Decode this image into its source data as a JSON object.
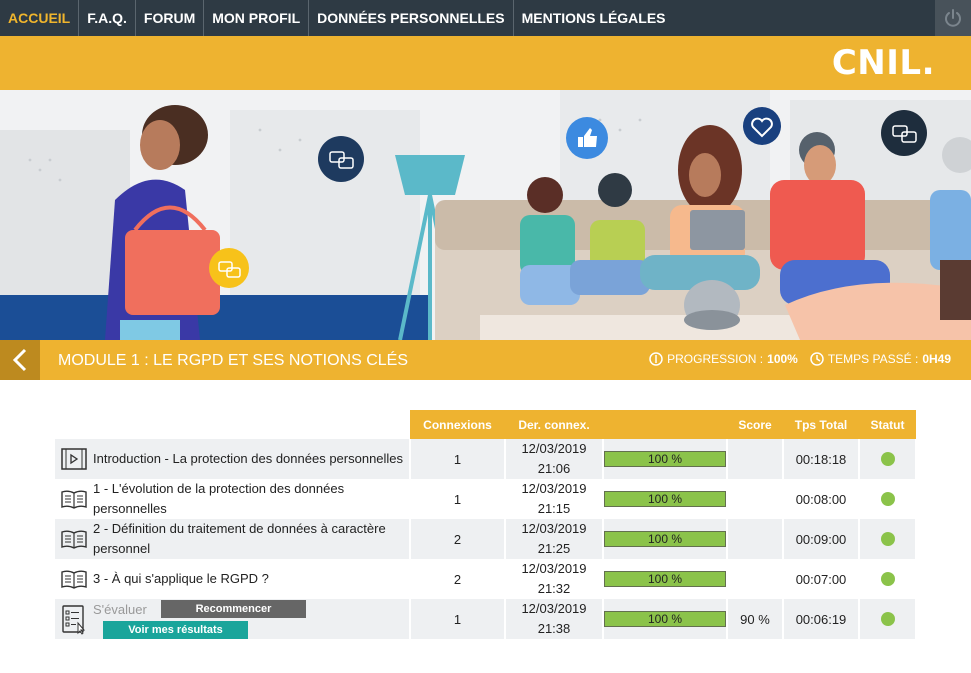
{
  "nav": {
    "items": [
      {
        "label": "ACCUEIL",
        "active": true
      },
      {
        "label": "F.A.Q."
      },
      {
        "label": "FORUM"
      },
      {
        "label": "MON PROFIL"
      },
      {
        "label": "DONNÉES PERSONNELLES"
      },
      {
        "label": "MENTIONS LÉGALES"
      }
    ],
    "power_icon": "power-icon"
  },
  "brand": {
    "logo": "CNIL."
  },
  "module": {
    "title": "MODULE 1 : LE RGPD ET SES NOTIONS CLÉS",
    "progress_label": "PROGRESSION :",
    "progress_value": "100%",
    "time_label": "TEMPS PASSÉ :",
    "time_value": "0H49"
  },
  "table": {
    "headers": [
      "Connexions",
      "Der. connex.",
      "Score",
      "Tps Total",
      "Statut"
    ],
    "rows": [
      {
        "icon": "video-icon",
        "title": "Introduction - La protection des données personnelles",
        "connexions": "1",
        "date": "12/03/2019",
        "time": "21:06",
        "progress": "100 %",
        "score": "",
        "total": "00:18:18",
        "status": "complete"
      },
      {
        "icon": "book-icon",
        "title": "1 - L'évolution de la protection des données personnelles",
        "connexions": "1",
        "date": "12/03/2019",
        "time": "21:15",
        "progress": "100 %",
        "score": "",
        "total": "00:08:00",
        "status": "complete"
      },
      {
        "icon": "book-icon",
        "title": "2 - Définition du traitement de données à caractère personnel",
        "connexions": "2",
        "date": "12/03/2019",
        "time": "21:25",
        "progress": "100 %",
        "score": "",
        "total": "00:09:00",
        "status": "complete"
      },
      {
        "icon": "book-icon",
        "title": "3 - À qui s'applique le RGPD ?",
        "connexions": "2",
        "date": "12/03/2019",
        "time": "21:32",
        "progress": "100 %",
        "score": "",
        "total": "00:07:00",
        "status": "complete"
      }
    ],
    "eval": {
      "icon": "quiz-icon",
      "label": "S'évaluer",
      "restart_label": "Recommencer",
      "results_label": "Voir mes résultats",
      "connexions": "1",
      "date": "12/03/2019",
      "time": "21:38",
      "progress": "100 %",
      "score": "90 %",
      "total": "00:06:19",
      "status": "complete"
    }
  },
  "colors": {
    "accent": "#eeb330",
    "nav_bg": "#2e3a44",
    "progress": "#8bc34a",
    "results_button": "#1aa59b"
  }
}
